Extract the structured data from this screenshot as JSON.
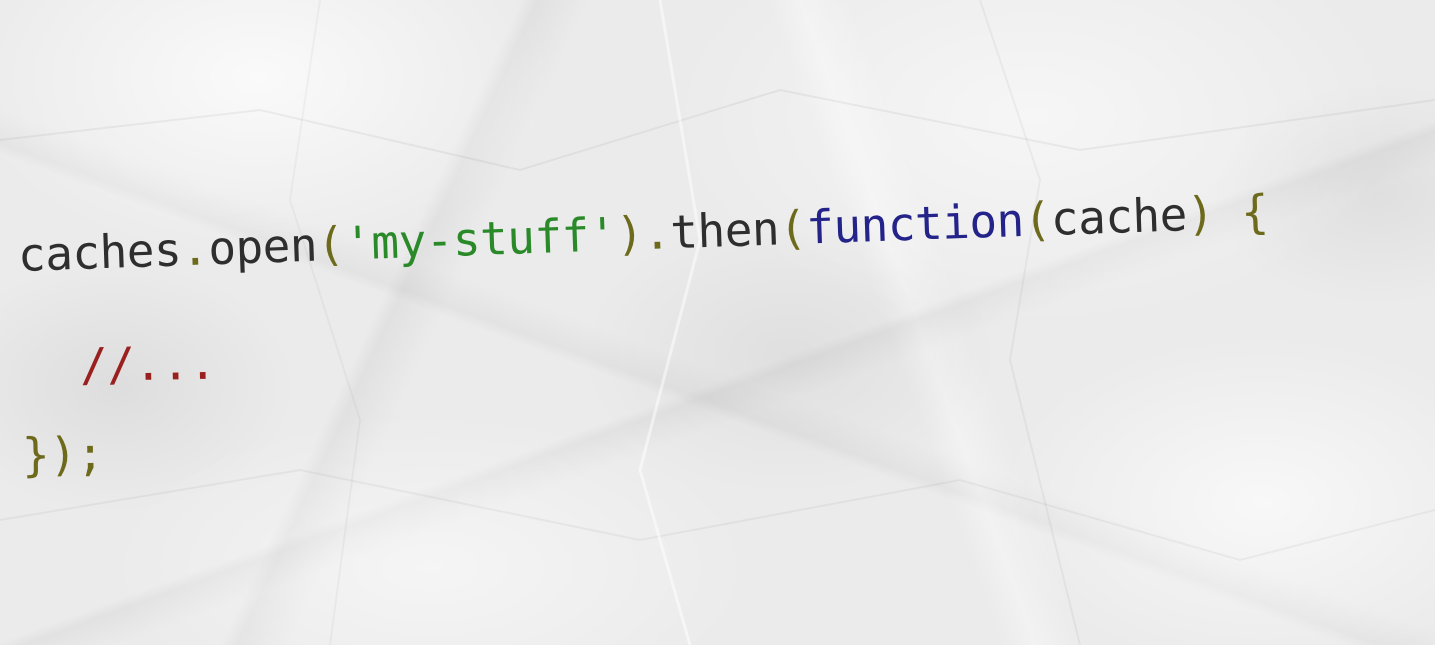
{
  "code": {
    "line1": {
      "caches": "caches",
      "dot1": ".",
      "open": "open",
      "paren_open1": "(",
      "string": "'my-stuff'",
      "paren_close1": ")",
      "dot2": ".",
      "then": "then",
      "paren_open2": "(",
      "keyword": "function",
      "paren_open3": "(",
      "param": "cache",
      "paren_close3": ")",
      "space": " ",
      "brace_open": "{"
    },
    "line2": {
      "comment": "//..."
    },
    "line3": {
      "closing": "});"
    }
  },
  "colors": {
    "identifier": "#2e2e2e",
    "punctuation": "#6d6a1c",
    "string": "#2a8a2a",
    "keyword": "#23238a",
    "comment": "#9a2020",
    "paper": "#ebebeb"
  }
}
